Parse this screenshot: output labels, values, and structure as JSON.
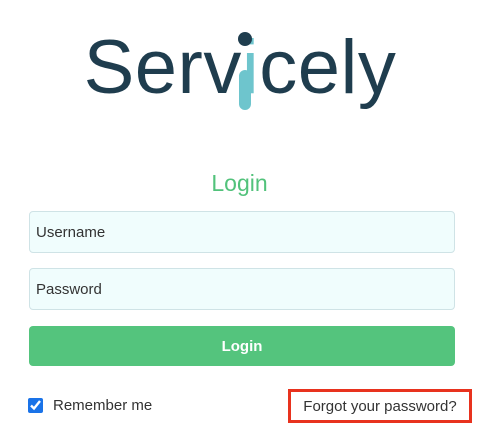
{
  "logo": {
    "text": "Servicely",
    "text_color": "#1f3d4e",
    "accent_color": "#6ec5cd"
  },
  "login_form": {
    "heading": "Login",
    "username_placeholder": "Username",
    "password_placeholder": "Password",
    "submit_label": "Login",
    "remember_me_label": "Remember me",
    "remember_me_checked": true,
    "forgot_password_label": "Forgot your password?"
  },
  "colors": {
    "primary_green": "#54c47d",
    "heading_green": "#52c27b",
    "field_background": "#f0fdfd",
    "highlight_border": "#e8321e"
  }
}
